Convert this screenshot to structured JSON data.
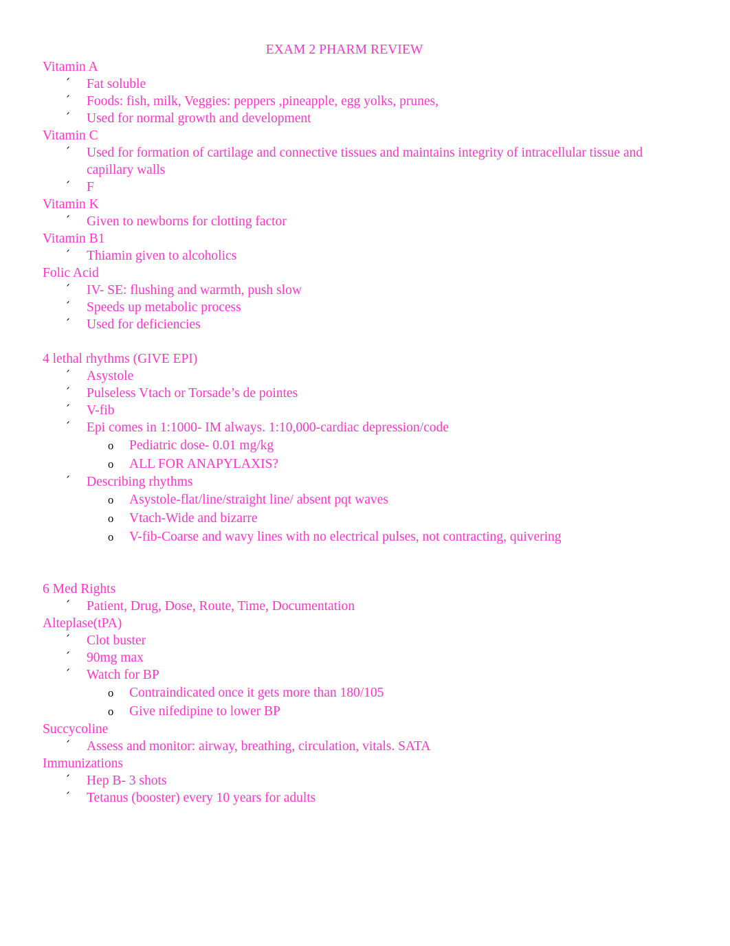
{
  "document": {
    "title": "EXAM 2 PHARM REVIEW",
    "text_color": "#ff33cc",
    "bullet_color": "#000000",
    "background_color": "#ffffff",
    "bullet_level1_glyph": "´",
    "bullet_level2_glyph": "o"
  },
  "sections": [
    {
      "heading": "Vitamin A",
      "items": [
        {
          "level": 1,
          "text": "Fat soluble"
        },
        {
          "level": 1,
          "text": "Foods: fish, milk, Veggies: peppers ,pineapple, egg yolks, prunes,"
        },
        {
          "level": 1,
          "text": "Used for normal growth and development"
        }
      ]
    },
    {
      "heading": "Vitamin C",
      "items": [
        {
          "level": 1,
          "text": "Used for formation of cartilage and connective tissues and maintains integrity of intracellular tissue and capillary walls"
        },
        {
          "level": 1,
          "text": "F"
        }
      ]
    },
    {
      "heading": "Vitamin K",
      "items": [
        {
          "level": 1,
          "text": "Given to newborns for clotting factor"
        }
      ]
    },
    {
      "heading": "Vitamin B1",
      "items": [
        {
          "level": 1,
          "text": "Thiamin given to alcoholics"
        }
      ]
    },
    {
      "heading": "Folic Acid",
      "items": [
        {
          "level": 1,
          "text": "IV- SE: flushing and warmth, push slow"
        },
        {
          "level": 1,
          "text": "Speeds up metabolic process"
        },
        {
          "level": 1,
          "text": "Used for deficiencies"
        }
      ]
    },
    {
      "heading": "",
      "blank_before": 1,
      "items": []
    },
    {
      "heading": "4 lethal rhythms (GIVE EPI)",
      "items": [
        {
          "level": 1,
          "text": "Asystole"
        },
        {
          "level": 1,
          "text": "Pulseless Vtach or Torsade’s de pointes"
        },
        {
          "level": 1,
          "text": "V-fib"
        },
        {
          "level": 1,
          "text": "Epi comes in 1:1000- IM always. 1:10,000-cardiac depression/code"
        },
        {
          "level": 2,
          "text": "Pediatric dose- 0.01 mg/kg"
        },
        {
          "level": 2,
          "text": "ALL FOR ANAPYLAXIS?"
        },
        {
          "level": 1,
          "text": "Describing rhythms"
        },
        {
          "level": 2,
          "text": "Asystole-flat/line/straight line/ absent pqt waves"
        },
        {
          "level": 2,
          "text": "Vtach-Wide and bizarre"
        },
        {
          "level": 2,
          "text": "V-fib-Coarse and wavy lines with no electrical pulses, not contracting, quivering"
        }
      ]
    },
    {
      "heading": "6 Med Rights",
      "blank_before": 2,
      "items": [
        {
          "level": 1,
          "text": "Patient, Drug, Dose, Route, Time, Documentation"
        }
      ]
    },
    {
      "heading": "Alteplase(tPA)",
      "items": [
        {
          "level": 1,
          "text": "Clot buster"
        },
        {
          "level": 1,
          "text": "90mg max"
        },
        {
          "level": 1,
          "text": "Watch for BP"
        },
        {
          "level": 2,
          "text": "Contraindicated once it gets more than 180/105"
        },
        {
          "level": 2,
          "text": "Give nifedipine to lower BP"
        }
      ]
    },
    {
      "heading": "Succycoline",
      "items": [
        {
          "level": 1,
          "text": "Assess and monitor: airway, breathing, circulation, vitals. SATA"
        }
      ]
    },
    {
      "heading": "Immunizations",
      "items": [
        {
          "level": 1,
          "text": "Hep B- 3 shots"
        },
        {
          "level": 1,
          "text": "Tetanus (booster) every 10 years for adults"
        }
      ]
    }
  ]
}
